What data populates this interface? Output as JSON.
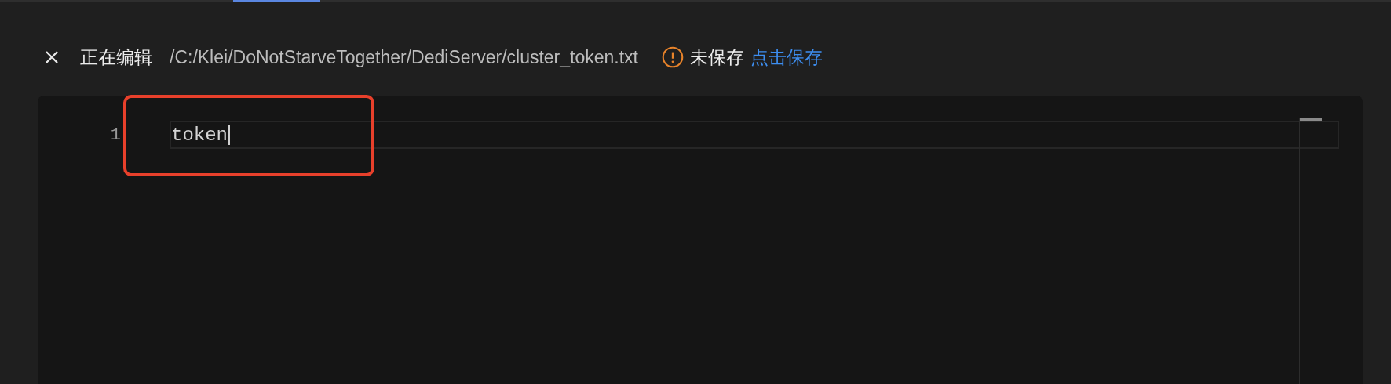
{
  "header": {
    "mode_label": "正在编辑",
    "path": "/C:/Klei/DoNotStarveTogether/DediServer/cluster_token.txt",
    "status": "未保存",
    "save_link": "点击保存"
  },
  "editor": {
    "lines": [
      {
        "number": "1",
        "text": "token"
      }
    ]
  }
}
